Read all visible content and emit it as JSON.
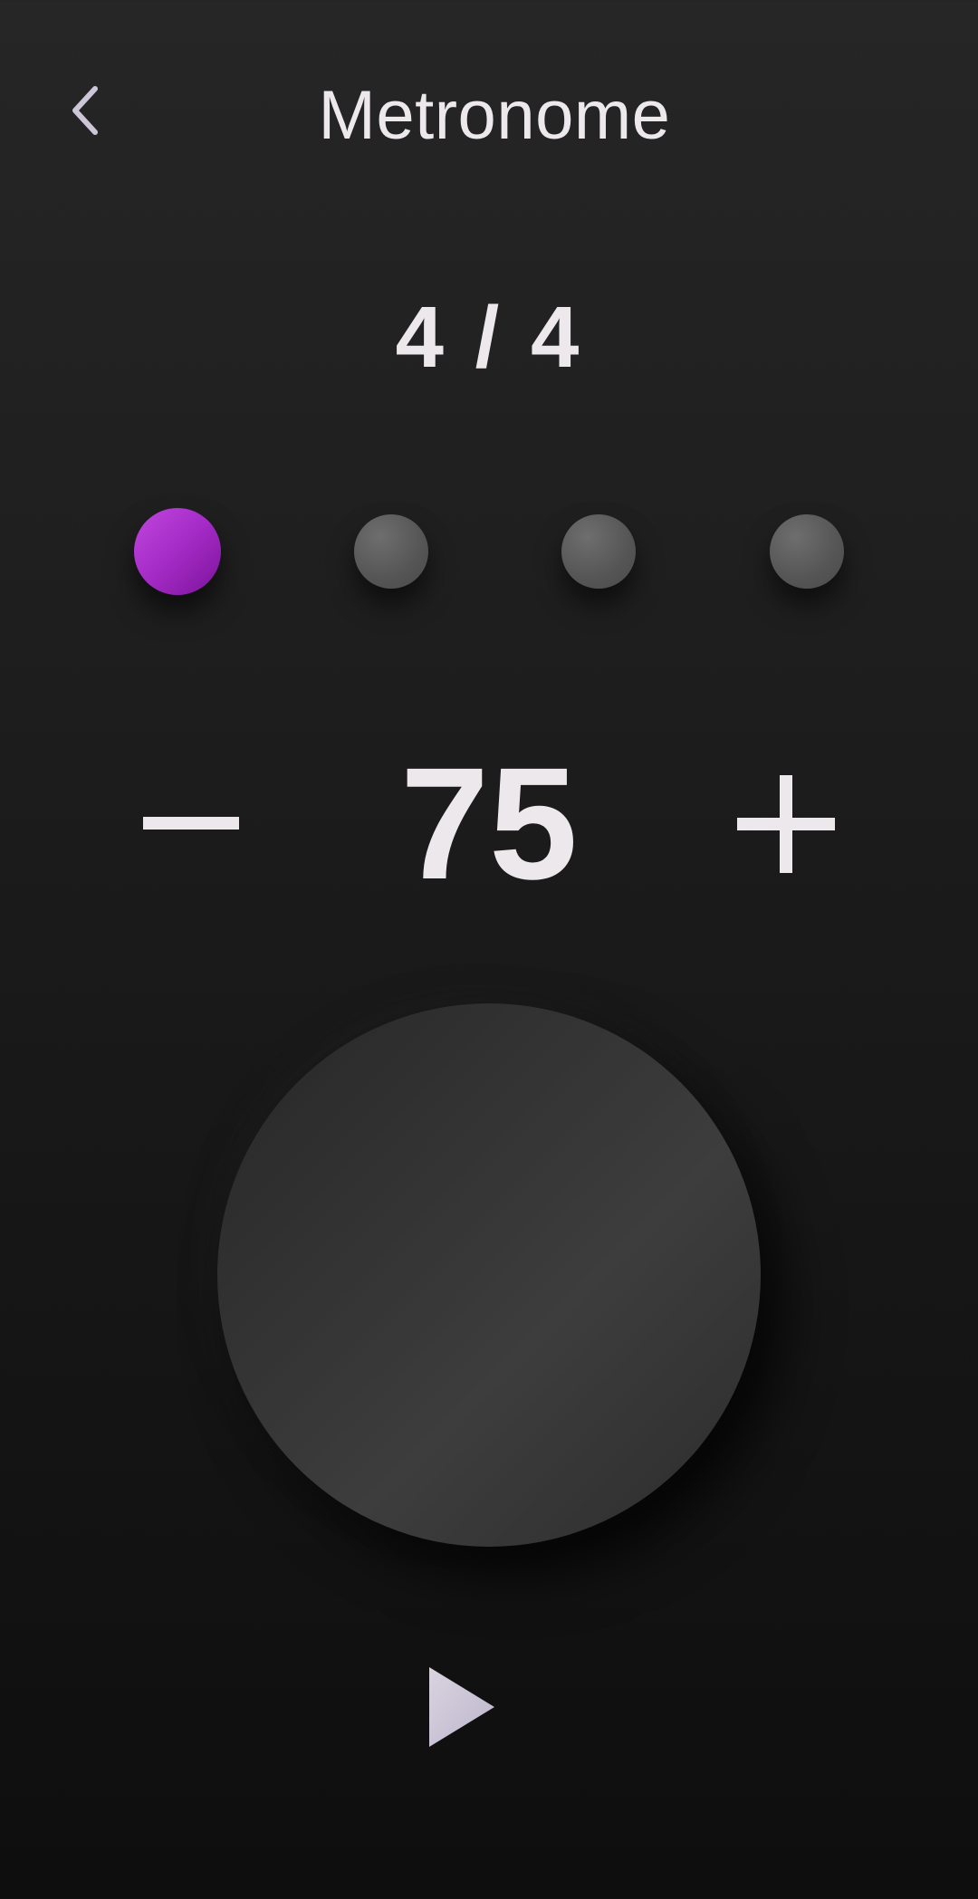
{
  "header": {
    "title": "Metronome",
    "back_icon": "chevron-left-icon"
  },
  "time_signature": {
    "label": "4 / 4",
    "beats_per_measure": 4
  },
  "beats": {
    "active_index": 0,
    "count": 4,
    "active_color": "#a42bc6",
    "inactive_color": "#555555"
  },
  "tempo": {
    "bpm": "75",
    "decrement_icon": "minus-icon",
    "increment_icon": "plus-icon"
  },
  "controls": {
    "play_icon": "play-icon"
  },
  "colors": {
    "background_top": "#262626",
    "background_bottom": "#0e0e0e",
    "text": "#ece8ec",
    "icon_tint": "#cdc6d8"
  }
}
